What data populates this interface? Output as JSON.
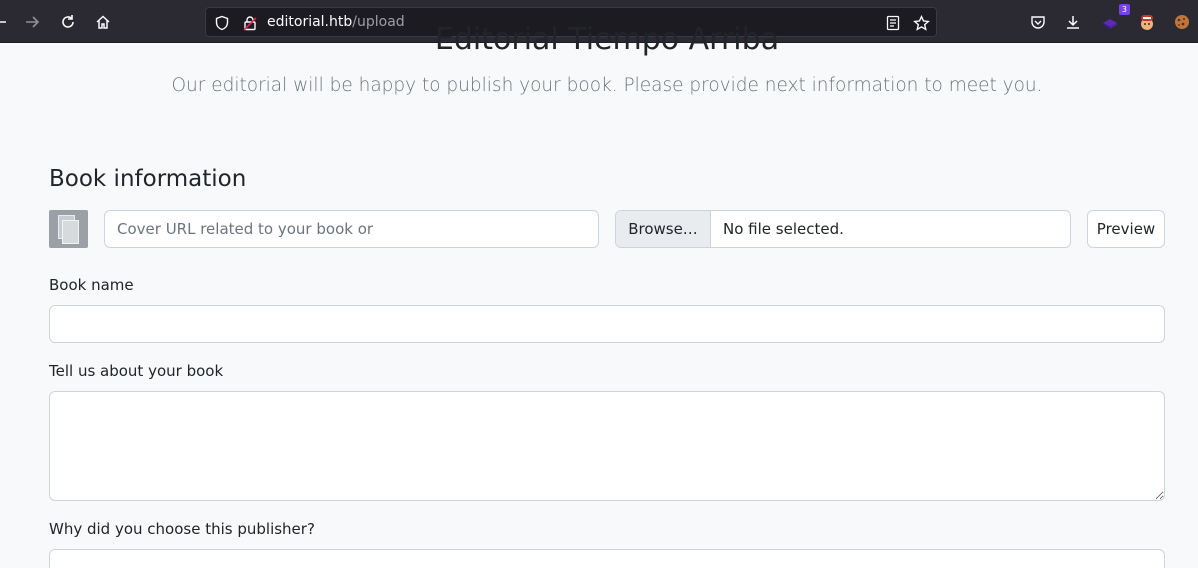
{
  "browser": {
    "url_host": "editorial.htb",
    "url_path": "/upload",
    "extension_badge": "3",
    "icons": [
      "back-arrow-icon",
      "forward-arrow-icon",
      "reload-icon",
      "home-icon",
      "shield-icon",
      "lock-icon",
      "reader-view-icon",
      "bookmark-star-icon",
      "pocket-icon",
      "download-icon",
      "extension-icon",
      "profile-icon",
      "cookie-icon"
    ]
  },
  "page": {
    "title": "Editorial Tiempo Arriba",
    "subtitle": "Our editorial will be happy to publish your book. Please provide next information to meet you."
  },
  "form": {
    "section_title": "Book information",
    "cover_url_placeholder": "Cover URL related to your book or",
    "browse_label": "Browse…",
    "file_status": "No file selected.",
    "preview_label": "Preview",
    "book_name_label": "Book name",
    "book_name_value": "",
    "about_label": "Tell us about your book",
    "about_value": "",
    "why_label": "Why did you choose this publisher?",
    "why_value": ""
  }
}
